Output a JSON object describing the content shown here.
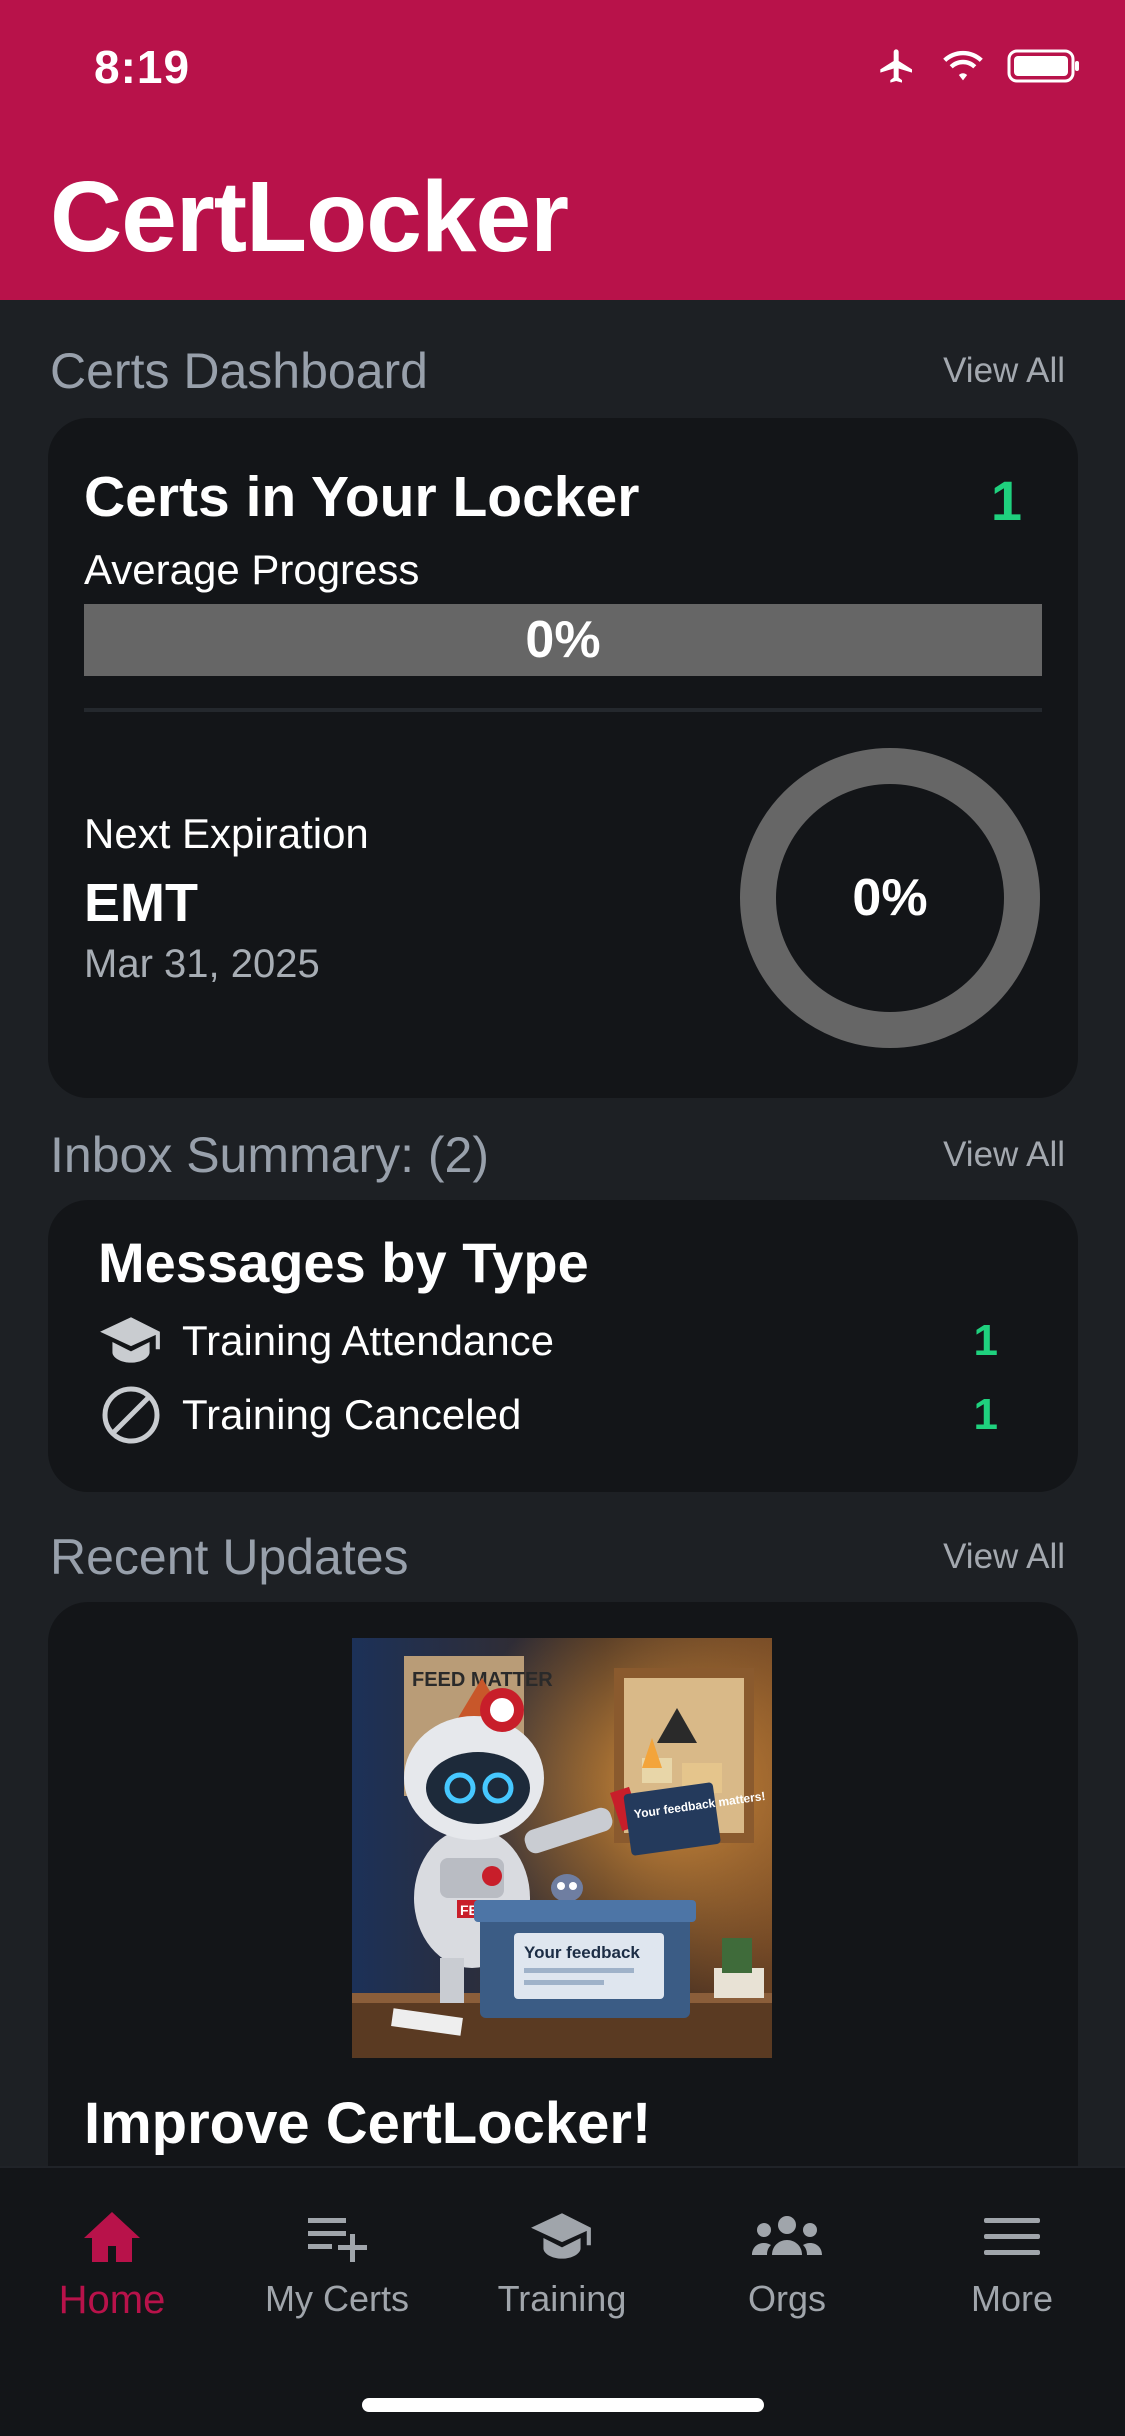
{
  "status_bar": {
    "time": "8:19"
  },
  "app": {
    "title": "CertLocker"
  },
  "certs_dashboard": {
    "section_title": "Certs Dashboard",
    "view_all": "View All",
    "card_title": "Certs in Your Locker",
    "count": "1",
    "average_label": "Average Progress",
    "average_progress_text": "0%",
    "average_progress_value": 0,
    "next_expiration_label": "Next Expiration",
    "next_expiration_name": "EMT",
    "next_expiration_date": "Mar 31, 2025",
    "ring_progress_text": "0%",
    "ring_progress_value": 0
  },
  "inbox": {
    "section_title": "Inbox Summary: (2)",
    "view_all": "View All",
    "card_title": "Messages by Type",
    "items": [
      {
        "icon": "graduation-cap-icon",
        "label": "Training Attendance",
        "count": "1"
      },
      {
        "icon": "ban-icon",
        "label": "Training Canceled",
        "count": "1"
      }
    ]
  },
  "updates": {
    "section_title": "Recent Updates",
    "view_all": "View All",
    "items": [
      {
        "title": "Improve CertLocker!",
        "image_texts": {
          "box_label": "Your feedback",
          "card_label": "Your feedback matters!",
          "poster": "FEED MATTER",
          "badge": "FER"
        }
      }
    ]
  },
  "tabs": [
    {
      "label": "Home",
      "icon": "home-icon",
      "active": true
    },
    {
      "label": "My Certs",
      "icon": "list-add-icon",
      "active": false
    },
    {
      "label": "Training",
      "icon": "graduation-cap-icon",
      "active": false
    },
    {
      "label": "Orgs",
      "icon": "people-icon",
      "active": false
    },
    {
      "label": "More",
      "icon": "menu-icon",
      "active": false
    }
  ],
  "colors": {
    "brand": "#b8124a",
    "accent_green": "#1fd17e",
    "background": "#1d2024",
    "card": "#131518"
  }
}
